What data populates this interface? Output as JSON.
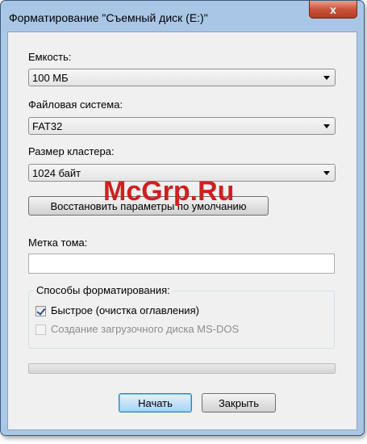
{
  "window": {
    "title": "Форматирование \"Съемный диск (E:)\"",
    "close_label": "x"
  },
  "capacity": {
    "label": "Емкость:",
    "value": "100 МБ"
  },
  "filesystem": {
    "label": "Файловая система:",
    "value": "FAT32"
  },
  "cluster": {
    "label": "Размер кластера:",
    "value": "1024 байт"
  },
  "restore_button": "Восстановить параметры по умолчанию",
  "volume_label": {
    "label": "Метка тома:",
    "value": ""
  },
  "format_options": {
    "title": "Способы форматирования:",
    "quick": {
      "label": "Быстрое (очистка оглавления)",
      "checked": true
    },
    "msdos": {
      "label": "Создание загрузочного диска MS-DOS",
      "checked": false,
      "disabled": true
    }
  },
  "progress": 0,
  "buttons": {
    "start": "Начать",
    "close": "Закрыть"
  },
  "watermark": "McGrp.Ru"
}
